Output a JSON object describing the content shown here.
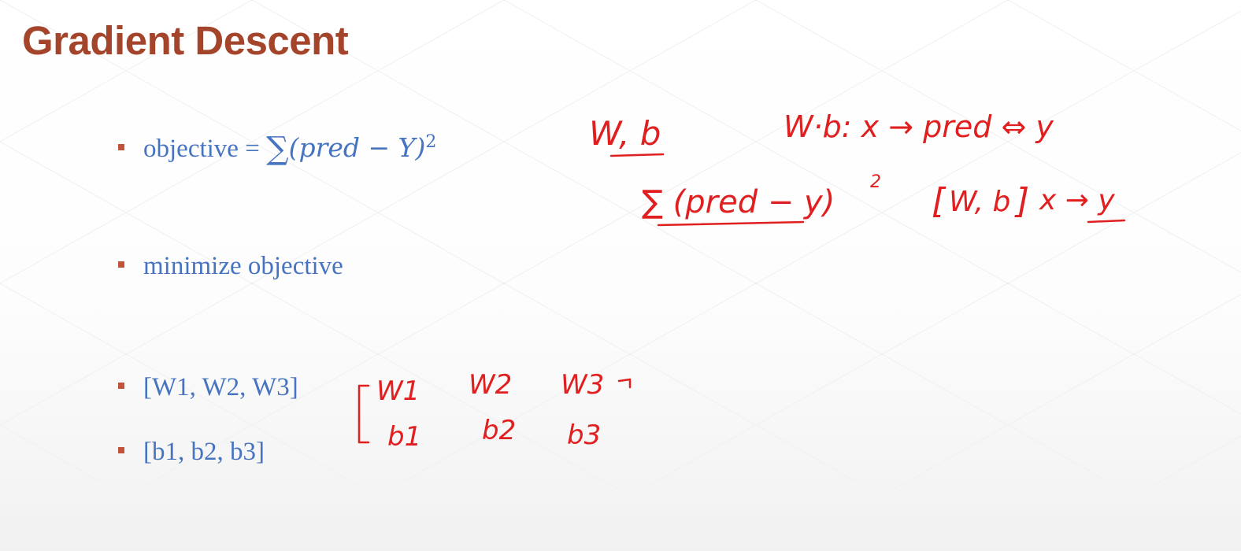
{
  "slide": {
    "title": "Gradient Descent",
    "bullets": [
      {
        "label": "objective = ",
        "formula": {
          "sigma": "∑",
          "body": "(pred  − Y)",
          "exponent": "2"
        }
      },
      {
        "label": "minimize objective"
      },
      {
        "label": "[W1, W2, W3]"
      },
      {
        "label": "[b1, b2, b3]"
      }
    ],
    "accent_color": "#a4452b",
    "bullet_text_color": "#4674c0",
    "ink_color": "#e02020"
  },
  "handwriting": {
    "line1_left": "W, b",
    "line1_right": "W·b:  x → pred ⇔ y",
    "line2_sum": "∑ (pred − y)",
    "line2_sum_exp": "2",
    "line2_right_open": "[",
    "line2_right_inner": "W, b",
    "line2_right_close": "]",
    "line2_right_tail": "x → y",
    "matrix_row1": [
      "W1",
      "W2",
      "W3"
    ],
    "matrix_row2": [
      "b1",
      "b2",
      "b3"
    ]
  }
}
